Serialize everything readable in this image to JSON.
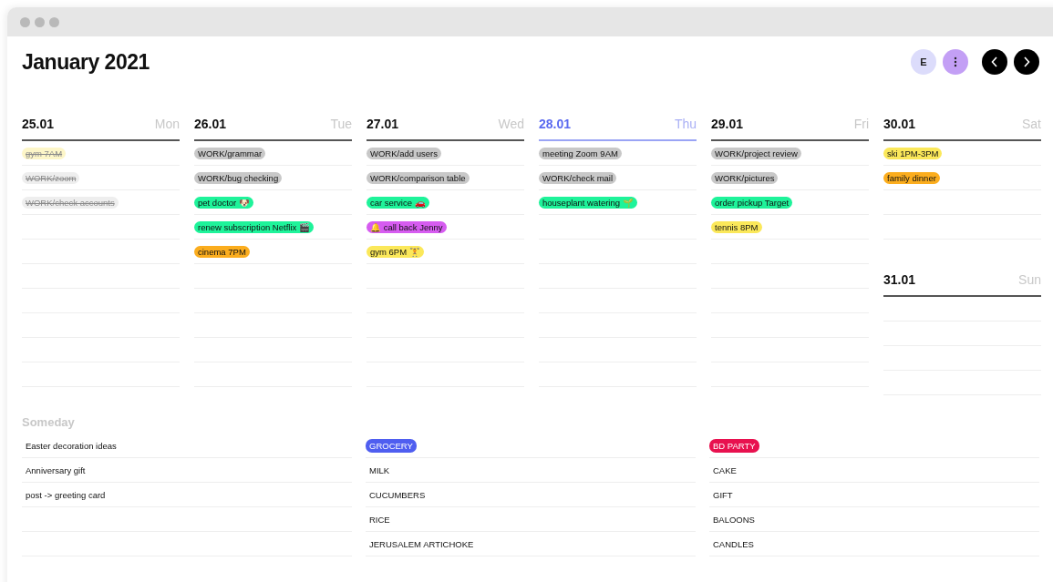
{
  "title": "January 2021",
  "header_buttons": [
    {
      "kind": "avatar",
      "label": "E"
    },
    {
      "kind": "more"
    },
    {
      "kind": "prev"
    },
    {
      "kind": "next"
    }
  ],
  "days": [
    {
      "date": "25.01",
      "weekday": "Mon",
      "selected": false,
      "tasks": [
        {
          "text": "gym 7AM",
          "color": "#fdf6c8",
          "done": true
        },
        {
          "text": "WORK/zoom",
          "color": "#eeeeee",
          "done": true
        },
        {
          "text": "WORK/check accounts",
          "color": "#eeeeee",
          "done": true
        }
      ]
    },
    {
      "date": "26.01",
      "weekday": "Tue",
      "selected": false,
      "tasks": [
        {
          "text": "WORK/grammar",
          "color": "#c8c8c8",
          "done": false
        },
        {
          "text": "WORK/bug checking",
          "color": "#c8c8c8",
          "done": false
        },
        {
          "text": "pet doctor 🐶",
          "color": "#1ef39a",
          "done": false
        },
        {
          "text": "renew subscription Netflix 🎬",
          "color": "#1ef39a",
          "done": false
        },
        {
          "text": "cinema 7PM",
          "color": "#fbad1e",
          "done": false
        }
      ]
    },
    {
      "date": "27.01",
      "weekday": "Wed",
      "selected": false,
      "tasks": [
        {
          "text": "WORK/add users",
          "color": "#c8c8c8",
          "done": false
        },
        {
          "text": "WORK/comparison table",
          "color": "#c8c8c8",
          "done": false
        },
        {
          "text": "car service 🚗",
          "color": "#1ef39a",
          "done": false
        },
        {
          "text": "🔔 call back Jenny",
          "color": "#d65cf0",
          "done": false
        },
        {
          "text": "gym 6PM 🏋",
          "color": "#fbe85a",
          "done": false
        }
      ]
    },
    {
      "date": "28.01",
      "weekday": "Thu",
      "selected": true,
      "tasks": [
        {
          "text": "meeting Zoom 9AM",
          "color": "#c8c8c8",
          "done": false
        },
        {
          "text": "WORK/check mail",
          "color": "#c8c8c8",
          "done": false
        },
        {
          "text": "houseplant watering 🌱",
          "color": "#1ef39a",
          "done": false
        }
      ]
    },
    {
      "date": "29.01",
      "weekday": "Fri",
      "selected": false,
      "tasks": [
        {
          "text": "WORK/project review",
          "color": "#c8c8c8",
          "done": false
        },
        {
          "text": "WORK/pictures",
          "color": "#c8c8c8",
          "done": false
        },
        {
          "text": "order pickup Target",
          "color": "#1ef39a",
          "done": false
        },
        {
          "text": "tennis 8PM",
          "color": "#fbe85a",
          "done": false
        }
      ]
    },
    {
      "date": "30.01",
      "weekday": "Sat",
      "selected": false,
      "tasks": [
        {
          "text": "ski 1PM-3PM",
          "color": "#fbe85a",
          "done": false
        },
        {
          "text": "family dinner",
          "color": "#fbad1e",
          "done": false
        }
      ]
    },
    {
      "date": "31.01",
      "weekday": "Sun",
      "selected": false
    }
  ],
  "someday": {
    "title": "Someday",
    "lists": [
      {
        "items": [
          "Easter decoration ideas",
          "Anniversary gift",
          "post -> greeting card"
        ]
      },
      {
        "tag": {
          "text": "GROCERY",
          "color": "#4f5ef0"
        },
        "items": [
          "MILK",
          "CUCUMBERS",
          "RICE",
          "JERUSALEM ARTICHOKE"
        ]
      },
      {
        "tag": {
          "text": "BD PARTY",
          "color": "#e8114f"
        },
        "items": [
          "CAKE",
          "GIFT",
          "BALOONS",
          "CANDLES"
        ]
      }
    ]
  }
}
